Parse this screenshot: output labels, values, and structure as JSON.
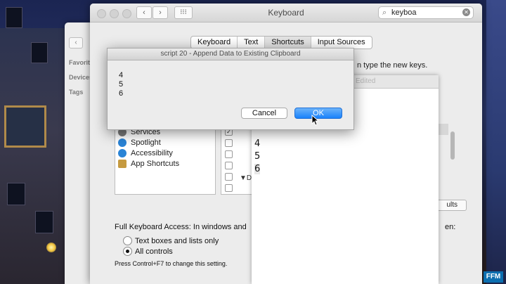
{
  "prefs_window": {
    "title": "Keyboard",
    "search_value": "keyboa",
    "tabs": [
      "Keyboard",
      "Text",
      "Shortcuts",
      "Input Sources"
    ],
    "active_tab": "Shortcuts",
    "hint_text": "n type the new keys.",
    "services": [
      {
        "label": "Services",
        "color": "#7a7a7a"
      },
      {
        "label": "Spotlight",
        "color": "#2a84d6"
      },
      {
        "label": "Accessibility",
        "color": "#2a84d6"
      },
      {
        "label": "App Shortcuts",
        "color": "#c59a40"
      }
    ],
    "mid_disclosure": "D",
    "fka_label": "Full Keyboard Access: In windows and",
    "fka_tail": "en:",
    "radio_options": [
      {
        "label": "Text boxes and lists only",
        "selected": false
      },
      {
        "label": "All controls",
        "selected": true
      }
    ],
    "note": "Press Control+F7 to change this setting.",
    "defaults_button": "ults"
  },
  "finder": {
    "sidebar_items": [
      "Favorit",
      "Devices",
      "Tags"
    ]
  },
  "editor": {
    "title": "Edited",
    "lines": [
      "4",
      "5",
      "6"
    ]
  },
  "dialog": {
    "title": "script 20 - Append Data to Existing Clipboard",
    "lines": [
      "4",
      "5",
      "6"
    ],
    "cancel_label": "Cancel",
    "ok_label": "OK"
  },
  "watermark": "FFM"
}
